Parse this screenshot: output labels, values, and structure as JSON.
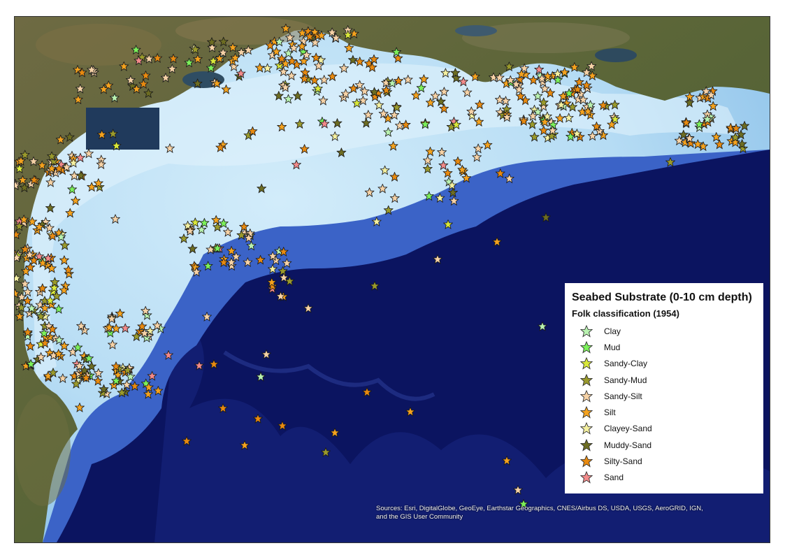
{
  "legend": {
    "title": "Seabed Substrate (0-10 cm depth)",
    "subtitle": "Folk classification (1954)",
    "items": [
      {
        "label": "Clay",
        "color": "#b9f2b0"
      },
      {
        "label": "Mud",
        "color": "#7cf05a"
      },
      {
        "label": "Sandy-Clay",
        "color": "#d9e83a"
      },
      {
        "label": "Sandy-Mud",
        "color": "#9a9a2c"
      },
      {
        "label": "Sandy-Silt",
        "color": "#f6d2a6"
      },
      {
        "label": "Silt",
        "color": "#f4a21e"
      },
      {
        "label": "Clayey-Sand",
        "color": "#f4f0a0"
      },
      {
        "label": "Muddy-Sand",
        "color": "#6d6d22"
      },
      {
        "label": "Silty-Sand",
        "color": "#e88a10"
      },
      {
        "label": "Sand",
        "color": "#f28a8a"
      }
    ]
  },
  "attribution": {
    "line1": "Sources: Esri, DigitalGlobe, GeoEye, Earthstar Geographics, CNES/Airbus DS, USDA, USGS, AeroGRID, IGN,",
    "line2": "and the GIS User Community"
  },
  "map_colors": {
    "land": "#5f6a3e",
    "shelf_light": "#c8e6f7",
    "shelf_mid": "#9fd0f0",
    "slope": "#6aa9e0",
    "deep": "#0b1460"
  }
}
